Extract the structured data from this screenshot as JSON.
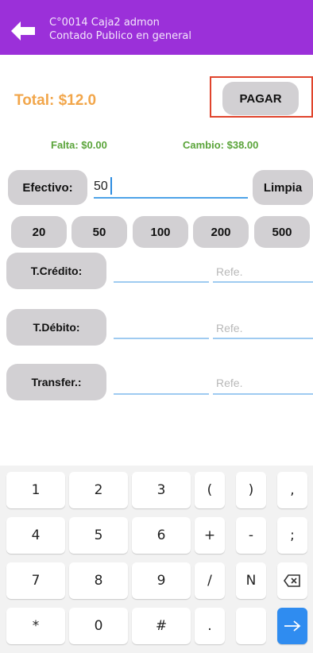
{
  "appbar": {
    "title_line1": "C°0014 Caja2 admon",
    "title_line2": "Contado Publico en general",
    "color": "#9b30d9"
  },
  "summary": {
    "total": "Total: $12.0",
    "pay_label": "PAGAR",
    "falta": "Falta: $0.00",
    "cambio": "Cambio: $38.00"
  },
  "cash": {
    "label": "Efectivo:",
    "value": "50",
    "clear_label": "Limpia"
  },
  "amounts": [
    "20",
    "50",
    "100",
    "200",
    "500"
  ],
  "methods": [
    {
      "label": "T.Crédito:",
      "ref_placeholder": "Refe."
    },
    {
      "label": "T.Débito:",
      "ref_placeholder": "Refe."
    },
    {
      "label": "Transfer.:",
      "ref_placeholder": "Refe."
    }
  ],
  "keyboard": {
    "rows": [
      [
        "1",
        "2",
        "3",
        "(",
        ")",
        ","
      ],
      [
        "4",
        "5",
        "6",
        "+",
        "-",
        ";"
      ],
      [
        "7",
        "8",
        "9",
        "/",
        "N",
        "backspace-icon"
      ],
      [
        "*",
        "0",
        "#",
        ".",
        "",
        "enter-arrow-icon"
      ]
    ]
  }
}
